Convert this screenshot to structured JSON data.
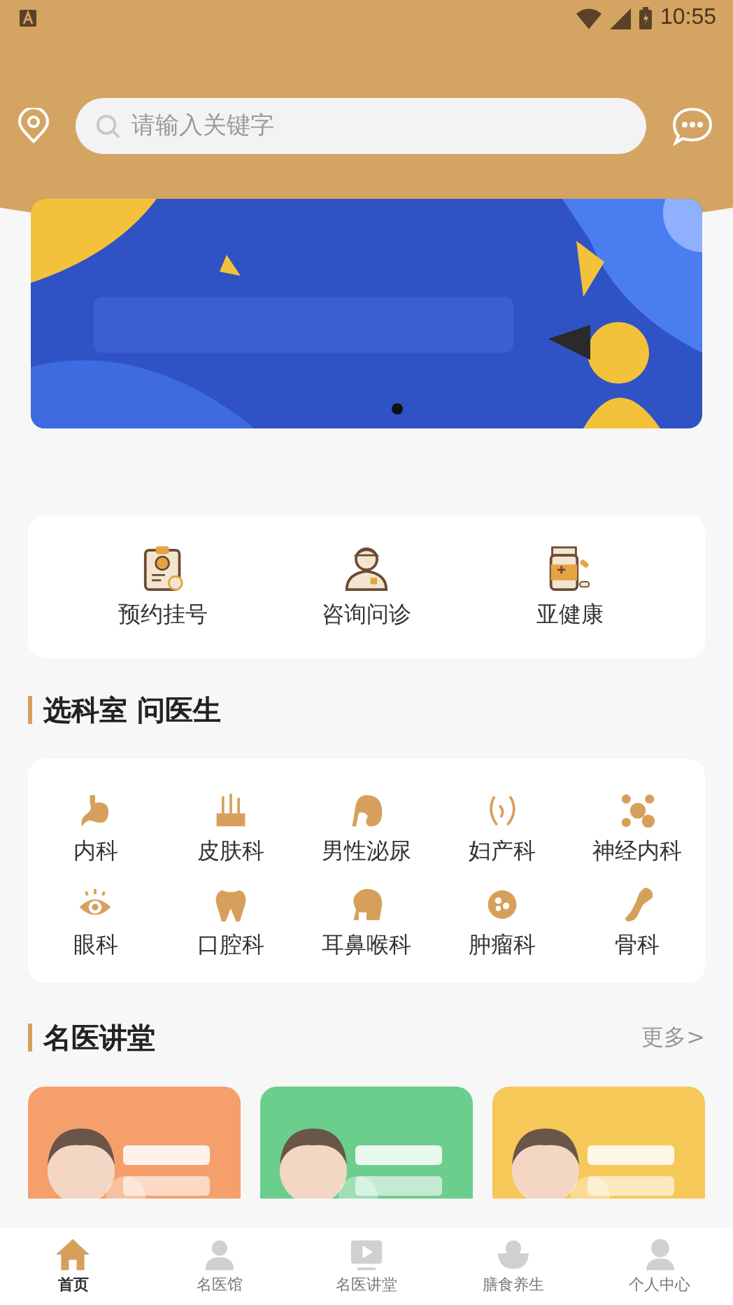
{
  "status_bar": {
    "time": "10:55"
  },
  "search": {
    "placeholder": "请输入关键字"
  },
  "quick_menu": [
    {
      "label": "预约挂号"
    },
    {
      "label": "咨询问诊"
    },
    {
      "label": "亚健康"
    }
  ],
  "departments_section": {
    "title": "选科室 问医生"
  },
  "departments": [
    {
      "label": "内科"
    },
    {
      "label": "皮肤科"
    },
    {
      "label": "男性泌尿"
    },
    {
      "label": "妇产科"
    },
    {
      "label": "神经内科"
    },
    {
      "label": "眼科"
    },
    {
      "label": "口腔科"
    },
    {
      "label": "耳鼻喉科"
    },
    {
      "label": "肿瘤科"
    },
    {
      "label": "骨科"
    }
  ],
  "lectures_section": {
    "title": "名医讲堂",
    "more": "更多>"
  },
  "tab_bar": [
    {
      "label": "首页",
      "selected": true
    },
    {
      "label": "名医馆",
      "selected": false
    },
    {
      "label": "名医讲堂",
      "selected": false
    },
    {
      "label": "膳食养生",
      "selected": false
    },
    {
      "label": "个人中心",
      "selected": false
    }
  ]
}
